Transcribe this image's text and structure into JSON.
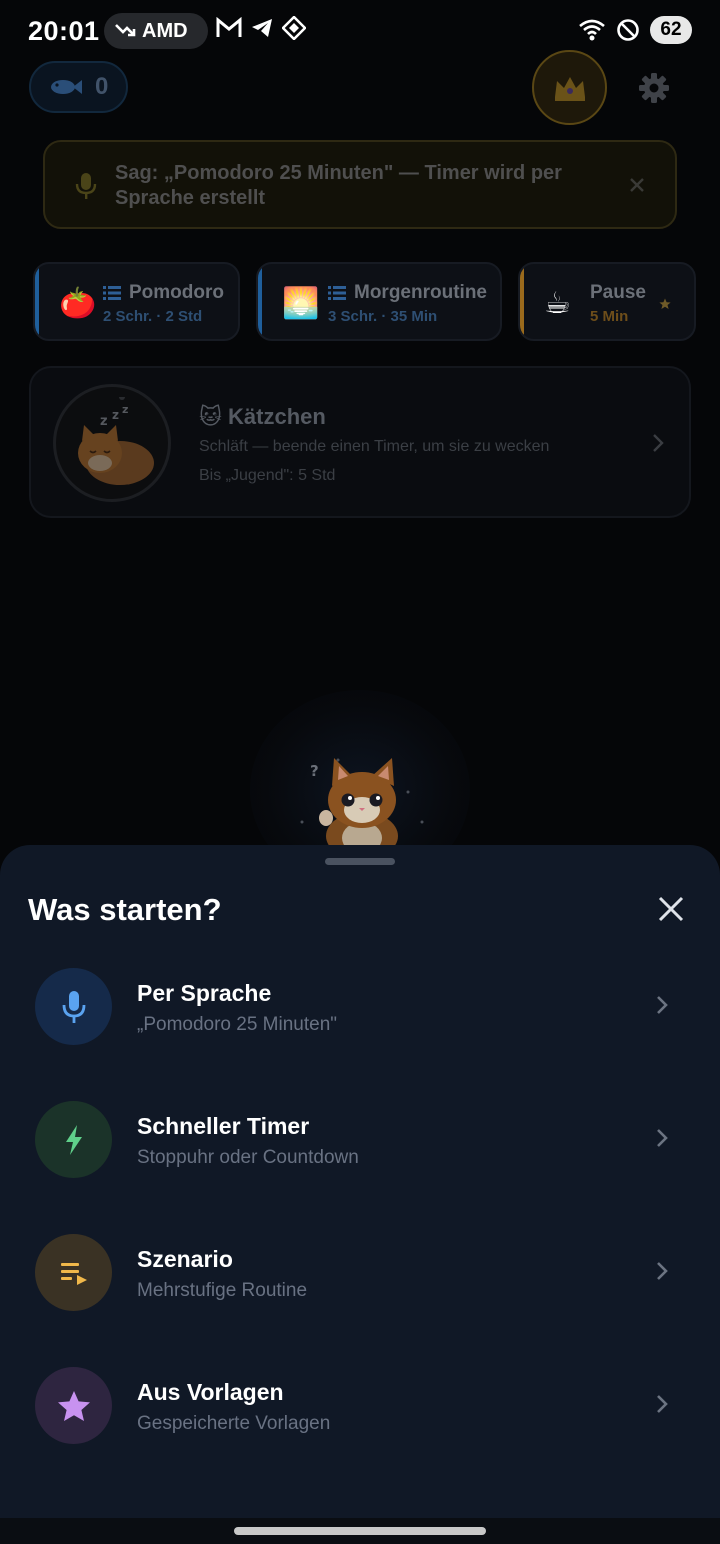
{
  "status_bar": {
    "time": "20:01",
    "pill_text": "AMD",
    "battery": "62",
    "icons": [
      "trending-down-icon",
      "gmail-icon",
      "telegram-icon",
      "app-icon",
      "wifi-icon",
      "do-not-disturb-icon"
    ]
  },
  "header": {
    "fish_count": "0",
    "crown_icon": "crown-icon",
    "settings_icon": "gear-icon"
  },
  "voice_banner": {
    "text": "Sag: „Pomodoro 25 Minuten\" — Timer wird per Sprache erstellt"
  },
  "templates": [
    {
      "emoji": "🍅",
      "title": "Pomodoro",
      "sub": "2 Schr. · 2 Std",
      "accent": "#1f5f9c",
      "sub_color": "#2e4f73"
    },
    {
      "emoji": "🌅",
      "title": "Morgenroutine",
      "sub": "3 Schr. · 35 Min",
      "accent": "#1f5f9c",
      "sub_color": "#2e4f73"
    },
    {
      "emoji": "☕",
      "title": "Pause",
      "sub": "5 Min",
      "accent": "#9a6a1c",
      "sub_color": "#6e4e1a"
    }
  ],
  "pet": {
    "title": "🐱 Kätzchen",
    "subtitle": "Schläft — beende einen Timer, um sie zu wecken",
    "progress": "Bis „Jugend\": 5 Std"
  },
  "sheet": {
    "title": "Was starten?",
    "options": [
      {
        "title": "Per Sprache",
        "subtitle": "„Pomodoro 25 Minuten\"",
        "icon": "mic-icon",
        "icon_bg": "#152a4a",
        "icon_color": "#5aa3f0"
      },
      {
        "title": "Schneller Timer",
        "subtitle": "Stoppuhr oder Countdown",
        "icon": "lightning-icon",
        "icon_bg": "#1b3329",
        "icon_color": "#5fd08a"
      },
      {
        "title": "Szenario",
        "subtitle": "Mehrstufige Routine",
        "icon": "playlist-icon",
        "icon_bg": "#3a3224",
        "icon_color": "#f0b84a"
      },
      {
        "title": "Aus Vorlagen",
        "subtitle": "Gespeicherte Vorlagen",
        "icon": "star-icon",
        "icon_bg": "#2e2540",
        "icon_color": "#c892f0"
      }
    ]
  }
}
